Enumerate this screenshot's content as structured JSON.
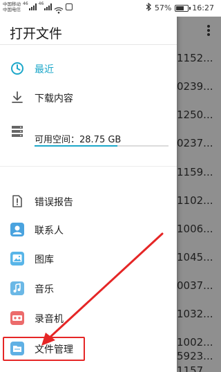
{
  "status_bar": {
    "carrier_1": "中国移动",
    "carrier_2": "中国电信",
    "network_1": "46",
    "network_2": "46",
    "battery_percent": "57%",
    "battery_level": 0.57,
    "time": "16:27"
  },
  "drawer": {
    "title": "打开文件",
    "items": [
      {
        "label": "最近",
        "icon": "clock-icon",
        "active": true
      },
      {
        "label": "下载内容",
        "icon": "download-icon",
        "active": false
      }
    ],
    "storage": {
      "label": "可用空间：28.75 GB",
      "icon": "storage-icon"
    },
    "apps": [
      {
        "label": "错误报告",
        "icon": "error-report-icon"
      },
      {
        "label": "联系人",
        "icon": "contacts-app-icon"
      },
      {
        "label": "图库",
        "icon": "gallery-app-icon"
      },
      {
        "label": "音乐",
        "icon": "music-app-icon"
      },
      {
        "label": "录音机",
        "icon": "recorder-app-icon"
      },
      {
        "label": "文件管理",
        "icon": "file-manager-app-icon"
      }
    ]
  },
  "background_list": {
    "rows": [
      "1152...",
      "0239...",
      "1250...",
      "0237...",
      "1159...",
      "1102...",
      "1006...",
      "1045...",
      "0037...",
      "1032...",
      "1002...",
      "5923...",
      "1157..."
    ]
  },
  "colors": {
    "accent": "#1ca7c9",
    "highlight": "#e52626"
  }
}
